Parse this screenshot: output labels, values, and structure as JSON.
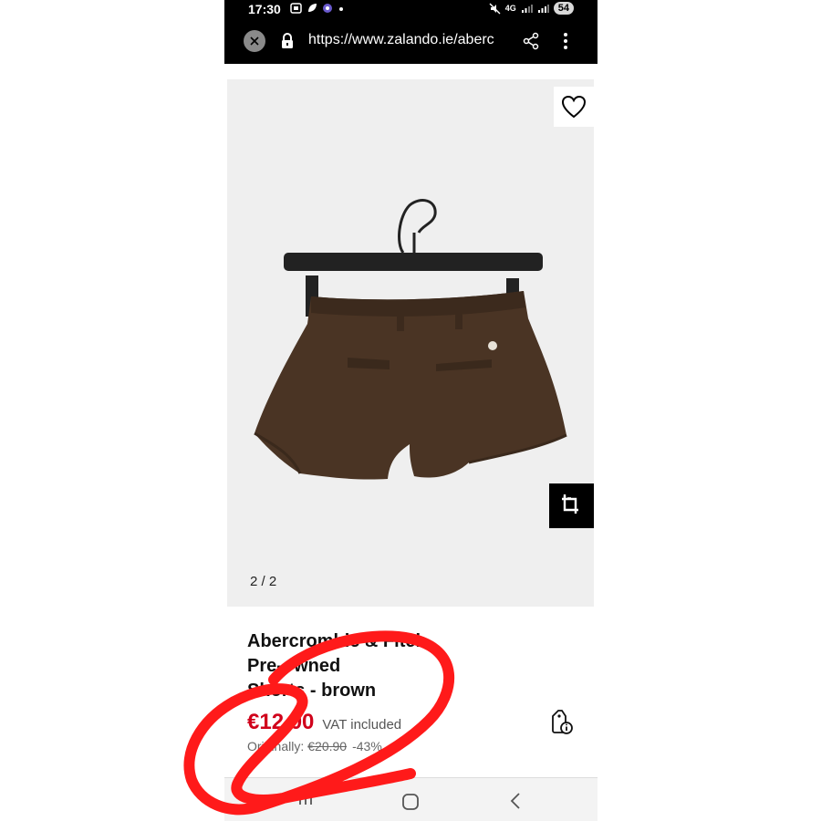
{
  "status_bar": {
    "time": "17:30",
    "battery": "54",
    "network": "4G"
  },
  "browser": {
    "url": "https://www.zalando.ie/aberc"
  },
  "gallery": {
    "counter": "2 / 2"
  },
  "product": {
    "title_line1": "Abercrombie & Fitch",
    "title_line2": "Pre-owned",
    "title_line3": "Shorts - brown",
    "price": "€12.00",
    "vat_label": "VAT included",
    "originally_label": "Originally:",
    "original_price": "€20.90",
    "discount": "-43%"
  },
  "colors": {
    "price_red": "#d0021b",
    "annotation_red": "#ff1a1a",
    "shorts_brown": "#4a3424"
  },
  "icons": [
    "close-icon",
    "lock-icon",
    "share-icon",
    "more-vertical-icon",
    "heart-icon",
    "crop-icon",
    "price-info-icon",
    "recent-apps-icon",
    "home-icon",
    "back-icon"
  ]
}
